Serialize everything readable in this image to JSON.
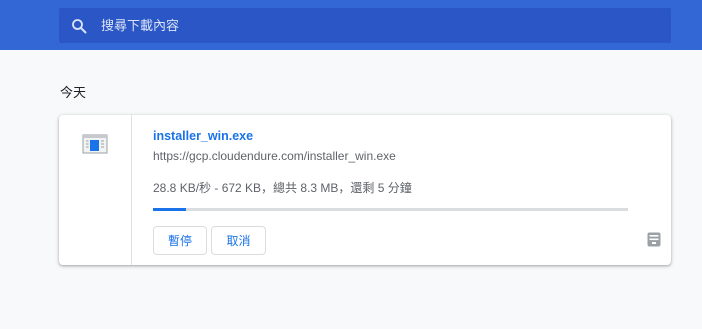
{
  "search": {
    "placeholder": "搜尋下載內容",
    "icon": "search-icon"
  },
  "section": {
    "date_label": "今天"
  },
  "download": {
    "file_name": "installer_win.exe",
    "url": "https://gcp.cloudendure.com/installer_win.exe",
    "status": "28.8 KB/秒 - 672 KB，總共 8.3 MB，還剩 5 分鐘",
    "progress_percent": 7,
    "pause_label": "暫停",
    "cancel_label": "取消",
    "file_icon": "exe-file-icon",
    "side_icon": "archive-icon"
  },
  "colors": {
    "topbar": "#3367d6",
    "search_bg": "#2a56c6",
    "accent": "#1a73e8",
    "progress_track": "#dadce0",
    "background": "#f8f9fa"
  }
}
